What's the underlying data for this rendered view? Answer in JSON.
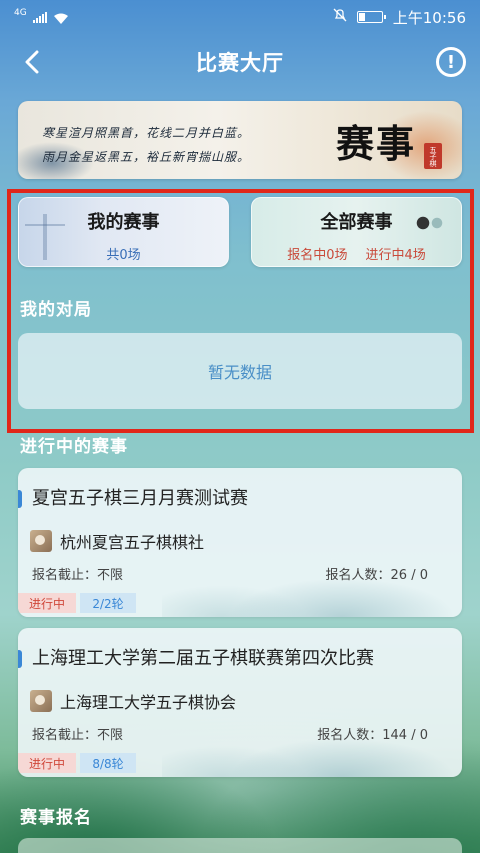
{
  "status_bar": {
    "network": "4G",
    "time": "上午10:56"
  },
  "nav": {
    "title": "比赛大厅",
    "info_symbol": "!"
  },
  "banner": {
    "poem_line1": "寒星渲月照黑首，花线二月并白蓝。",
    "poem_line2": "雨月金星返黑五，裕丘新宵揣山服。",
    "title": "赛事",
    "stamp": "五子棋"
  },
  "my_matches": {
    "heading": "我的赛事",
    "summary": "共0场"
  },
  "all_matches": {
    "heading": "全部赛事",
    "registering": "报名中0场",
    "in_progress": "进行中4场"
  },
  "my_games": {
    "title": "我的对局",
    "empty_text": "暂无数据"
  },
  "ongoing": {
    "title": "进行中的赛事",
    "items": [
      {
        "name": "夏宫五子棋三月月赛测试赛",
        "org": "杭州夏宫五子棋棋社",
        "deadline": "报名截止：不限",
        "count": "报名人数：26 / 0",
        "status": "进行中",
        "round": "2/2轮"
      },
      {
        "name": "上海理工大学第二届五子棋联赛第四次比赛",
        "org": "上海理工大学五子棋协会",
        "deadline": "报名截止：不限",
        "count": "报名人数：144 / 0",
        "status": "进行中",
        "round": "8/8轮"
      }
    ]
  },
  "registration": {
    "title": "赛事报名"
  }
}
